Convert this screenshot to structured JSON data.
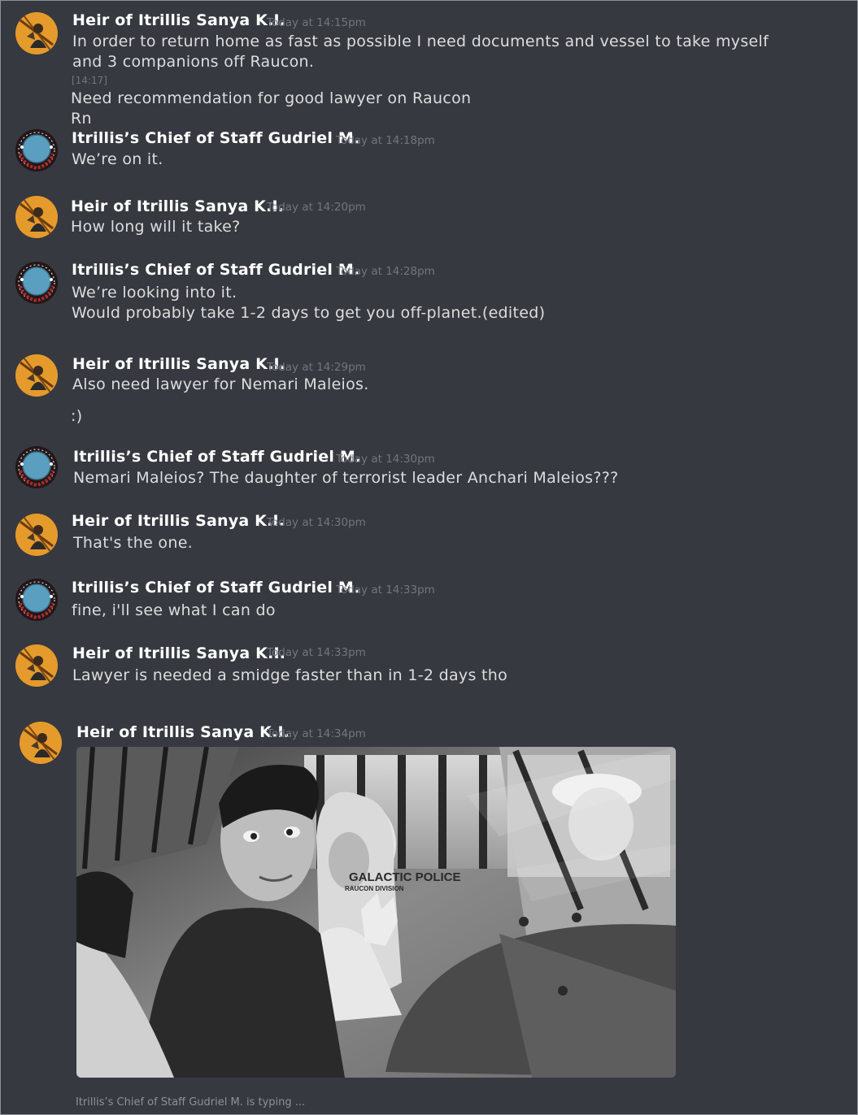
{
  "messages": [
    {
      "author": "Heir of Itrillis Sanya K.I.",
      "timestamp": "Today at 14:15pm",
      "lines": [
        "In order to return home as fast as possible I need documents and vessel to take myself",
        "and 3 companions off Raucon."
      ],
      "followup_timestamp": "[14:17]",
      "followup_lines": [
        "Need recommendation for good lawyer on Raucon",
        "Rn"
      ]
    },
    {
      "author": "Itrillis’s Chief of Staff Gudriel M.",
      "timestamp": "Today at 14:18pm",
      "lines": [
        "We’re on it."
      ]
    },
    {
      "author": "Heir of Itrillis Sanya K.I.",
      "timestamp": "Today at 14:20pm",
      "lines": [
        "How long will it take?"
      ]
    },
    {
      "author": "Itrillis’s Chief of Staff Gudriel M.",
      "timestamp": "Today at 14:28pm",
      "lines": [
        "We’re looking into it.",
        "Would probably take 1-2 days to get you off-planet.(edited)"
      ]
    },
    {
      "author": "Heir of Itrillis Sanya K.I.",
      "timestamp": "Today at 14:29pm",
      "lines": [
        "Also need lawyer for Nemari Maleios.",
        ":)"
      ]
    },
    {
      "author": "Itrillis’s Chief of Staff Gudriel M.",
      "timestamp": "Today at 14:30pm",
      "lines": [
        "Nemari Maleios? The daughter of terrorist leader Anchari Maleios???"
      ]
    },
    {
      "author": "Heir of Itrillis Sanya K.I.",
      "timestamp": "Today at 14:30pm",
      "lines": [
        "That's the one."
      ]
    },
    {
      "author": "Itrillis’s Chief of Staff Gudriel M.",
      "timestamp": "Today at 14:33pm",
      "lines": [
        "fine, i'll see what I can do"
      ]
    },
    {
      "author": "Heir of Itrillis Sanya K.I.",
      "timestamp": "Today at 14:33pm",
      "lines": [
        "Lawyer is needed a smidge faster than in 1-2 days tho"
      ]
    },
    {
      "author": "Heir of Itrillis Sanya K.I.",
      "timestamp": "Today at 14:34pm",
      "lines": []
    }
  ],
  "attachment": {
    "sign_line1": "GALACTIC POLICE",
    "sign_line2": "RAUCON DIVISION",
    "icon": "image-attachment"
  },
  "typing_indicator": "Itrillis’s Chief of Staff Gudriel M. is typing ...",
  "colors": {
    "background": "#36393f",
    "username": "#ffffff",
    "message_text": "#dcddde",
    "timestamp": "#72767d",
    "heir_avatar": "#e0962a",
    "chief_avatar_badge": "#5a9fbf"
  }
}
